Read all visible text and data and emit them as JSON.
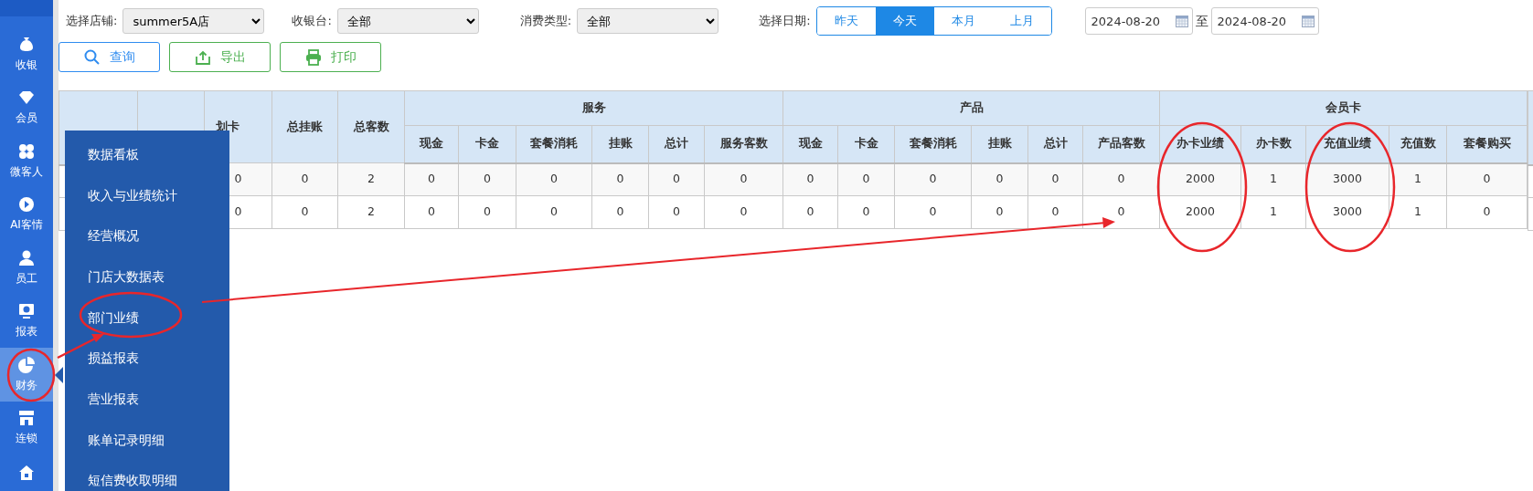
{
  "sidebar": {
    "items": [
      {
        "label": "收银",
        "selected": false
      },
      {
        "label": "会员",
        "selected": false
      },
      {
        "label": "微客人",
        "selected": false
      },
      {
        "label": "AI客情",
        "selected": false
      },
      {
        "label": "员工",
        "selected": false
      },
      {
        "label": "报表",
        "selected": false
      },
      {
        "label": "财务",
        "selected": true
      },
      {
        "label": "连锁",
        "selected": false
      },
      {
        "selected": false
      }
    ]
  },
  "filters": [
    {
      "label": "选择店铺:",
      "value": "summer5A店"
    },
    {
      "label": "收银台:",
      "value": "全部"
    },
    {
      "label": "消费类型:",
      "value": "全部"
    }
  ],
  "date_filter": {
    "label": "选择日期:",
    "buttons": [
      {
        "label": "昨天",
        "selected": false
      },
      {
        "label": "今天",
        "selected": true
      },
      {
        "label": "本月",
        "selected": false
      },
      {
        "label": "上月",
        "selected": false
      }
    ],
    "start": "2024-08-20",
    "separator": "至",
    "end": "2024-08-20"
  },
  "actions": [
    {
      "label": "查询",
      "kind": "search"
    },
    {
      "label": "导出",
      "kind": "export"
    },
    {
      "label": "打印",
      "kind": "print"
    }
  ],
  "table": {
    "columns": [
      {
        "label": "划卡"
      },
      {
        "label": "总挂账"
      },
      {
        "label": "总客数"
      },
      {
        "group": "服务",
        "colspan": 6,
        "children": [
          "现金",
          "卡金",
          "套餐消耗",
          "挂账",
          "总计",
          "服务客数"
        ]
      },
      {
        "group": "产品",
        "colspan": 6,
        "children": [
          "现金",
          "卡金",
          "套餐消耗",
          "挂账",
          "总计",
          "产品客数"
        ]
      },
      {
        "group": "会员卡",
        "colspan": 5,
        "children": [
          "办卡业绩",
          "办卡数",
          "充值业绩",
          "充值数",
          "套餐购买"
        ]
      }
    ],
    "rows": [
      [
        "0",
        "0",
        "2",
        "0",
        "0",
        "0",
        "0",
        "0",
        "0",
        "0",
        "0",
        "0",
        "0",
        "0",
        "0",
        "2000",
        "1",
        "3000",
        "1",
        "0"
      ],
      [
        "0",
        "0",
        "2",
        "0",
        "0",
        "0",
        "0",
        "0",
        "0",
        "0",
        "0",
        "0",
        "0",
        "0",
        "0",
        "2000",
        "1",
        "3000",
        "1",
        "0"
      ]
    ]
  },
  "flyout_menu": {
    "items": [
      "数据看板",
      "收入与业绩统计",
      "经营概况",
      "门店大数据表",
      "部门业绩",
      "损益报表",
      "营业报表",
      "账单记录明细",
      "短信费收取明细"
    ]
  }
}
